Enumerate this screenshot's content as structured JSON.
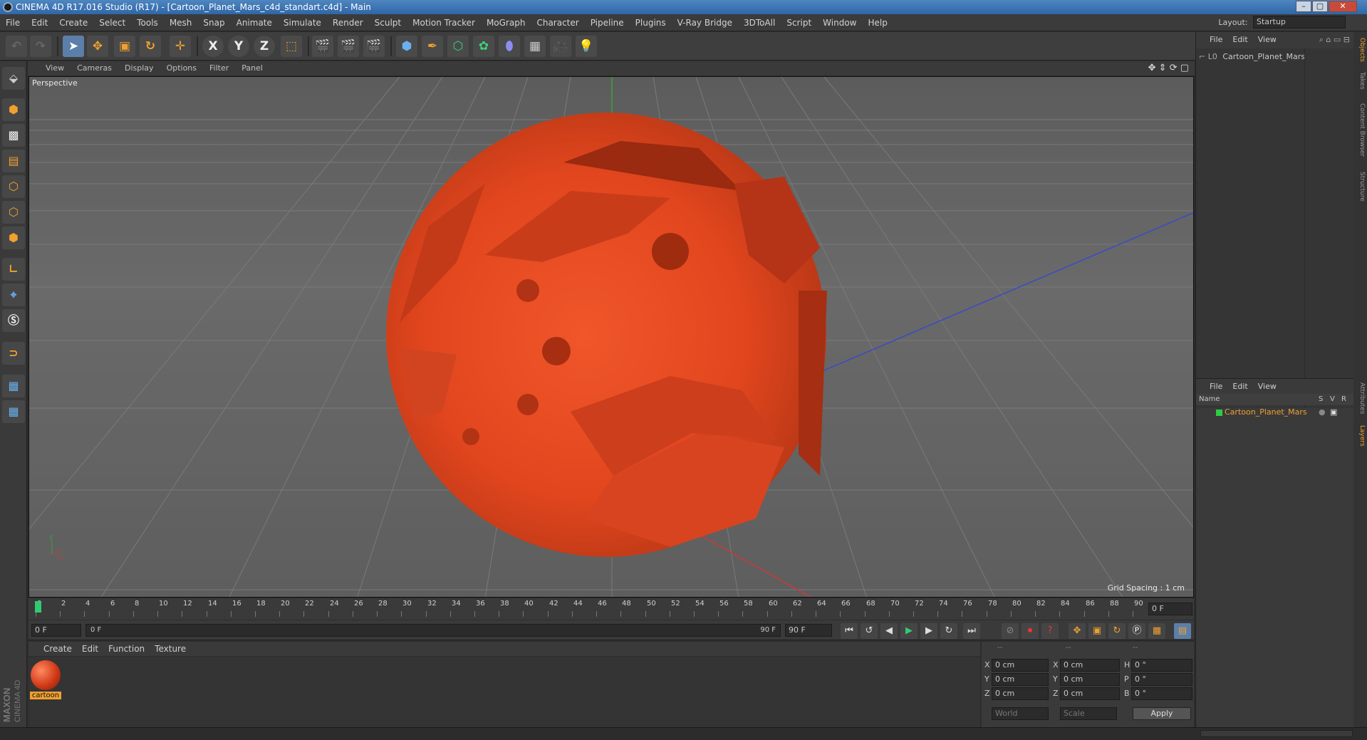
{
  "window": {
    "title": "CINEMA 4D R17.016 Studio (R17) - [Cartoon_Planet_Mars_c4d_standart.c4d] - Main",
    "controls": [
      "–",
      "▢",
      "✕"
    ]
  },
  "menubar": {
    "items": [
      "File",
      "Edit",
      "Create",
      "Select",
      "Tools",
      "Mesh",
      "Snap",
      "Animate",
      "Simulate",
      "Render",
      "Sculpt",
      "Motion Tracker",
      "MoGraph",
      "Character",
      "Pipeline",
      "Plugins",
      "V-Ray Bridge",
      "3DToAll",
      "Script",
      "Window",
      "Help"
    ],
    "layout_label": "Layout:",
    "layout_value": "Startup"
  },
  "toolbar": {
    "x_label": "X",
    "y_label": "Y",
    "z_label": "Z"
  },
  "viewport": {
    "menu": [
      "View",
      "Cameras",
      "Display",
      "Options",
      "Filter",
      "Panel"
    ],
    "label": "Perspective",
    "grid_spacing": "Grid Spacing : 1 cm",
    "axis_y": "y",
    "axis_z": "z"
  },
  "timeline": {
    "ticks": [
      "0",
      "2",
      "4",
      "6",
      "8",
      "10",
      "12",
      "14",
      "16",
      "18",
      "20",
      "22",
      "24",
      "26",
      "28",
      "30",
      "32",
      "34",
      "36",
      "38",
      "40",
      "42",
      "44",
      "46",
      "48",
      "50",
      "52",
      "54",
      "56",
      "58",
      "60",
      "62",
      "64",
      "66",
      "68",
      "70",
      "72",
      "74",
      "76",
      "78",
      "80",
      "82",
      "84",
      "86",
      "88",
      "90"
    ],
    "current_frame": "0 F"
  },
  "timebar": {
    "start_field": "0 F",
    "range_start": "0 F",
    "range_end": "90 F",
    "end_field": "90 F"
  },
  "materials": {
    "menu": [
      "Create",
      "Edit",
      "Function",
      "Texture"
    ],
    "items": [
      {
        "name": "cartoon"
      }
    ]
  },
  "coordinates": {
    "header": [
      "--",
      "--",
      "--"
    ],
    "rows": [
      {
        "axis1": "X",
        "val1": "0 cm",
        "axis2": "X",
        "val2": "0 cm",
        "axis3": "H",
        "val3": "0 °"
      },
      {
        "axis1": "Y",
        "val1": "0 cm",
        "axis2": "Y",
        "val2": "0 cm",
        "axis3": "P",
        "val3": "0 °"
      },
      {
        "axis1": "Z",
        "val1": "0 cm",
        "axis2": "Z",
        "val2": "0 cm",
        "axis3": "B",
        "val3": "0 °"
      }
    ],
    "mode1": "World",
    "mode2": "Scale",
    "apply_label": "Apply"
  },
  "object_manager": {
    "menu": [
      "File",
      "Edit",
      "View"
    ],
    "objects": [
      {
        "name": "Cartoon_Planet_Mars"
      }
    ]
  },
  "layer_manager": {
    "menu": [
      "File",
      "Edit",
      "View"
    ],
    "columns": {
      "name": "Name",
      "s": "S",
      "v": "V",
      "r": "R"
    },
    "layers": [
      {
        "name": "Cartoon_Planet_Mars",
        "color": "#2ecc40"
      }
    ]
  },
  "right_dock_tabs": [
    "Objects",
    "Takes",
    "Content Browser",
    "Structure",
    "Attributes",
    "Layers"
  ],
  "brand": {
    "line1": "MAXON",
    "line2": "CINEMA 4D"
  },
  "colors": {
    "accent": "#f0a030",
    "active_blue": "#5b7fa8",
    "planet": "#e2461e"
  }
}
